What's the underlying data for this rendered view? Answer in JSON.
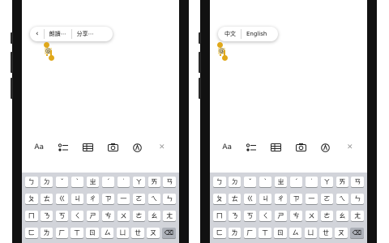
{
  "left_phone": {
    "popup": {
      "back_icon": "‹",
      "read_label": "朗讀⋯",
      "share_label": "分享⋯"
    },
    "selected_text": "@"
  },
  "right_phone": {
    "popup": {
      "chinese_label": "中文",
      "english_label": "English"
    },
    "selected_text": "@"
  },
  "toolbar": {
    "format_label": "Aa",
    "icons": [
      "format-text-icon",
      "checklist-icon",
      "table-icon",
      "camera-icon",
      "markup-pen-icon",
      "close-icon"
    ],
    "close_glyph": "✕"
  },
  "keyboard": {
    "rows": [
      [
        "ㄅ",
        "ㄉ",
        "ˇ",
        "ˋ",
        "ㄓ",
        "ˊ",
        "˙",
        "ㄚ",
        "ㄞ",
        "ㄢ"
      ],
      [
        "ㄆ",
        "ㄊ",
        "ㄍ",
        "ㄐ",
        "ㄔ",
        "ㄗ",
        "一",
        "ㄛ",
        "ㄟ",
        "ㄣ"
      ],
      [
        "ㄇ",
        "ㄋ",
        "ㄎ",
        "ㄑ",
        "ㄕ",
        "ㄘ",
        "ㄨ",
        "ㄜ",
        "ㄠ",
        "ㄤ"
      ],
      [
        "ㄈ",
        "ㄌ",
        "ㄏ",
        "ㄒ",
        "ㄖ",
        "ㄙ",
        "ㄩ",
        "ㄝ",
        "ㄡ",
        "⌫"
      ]
    ]
  }
}
